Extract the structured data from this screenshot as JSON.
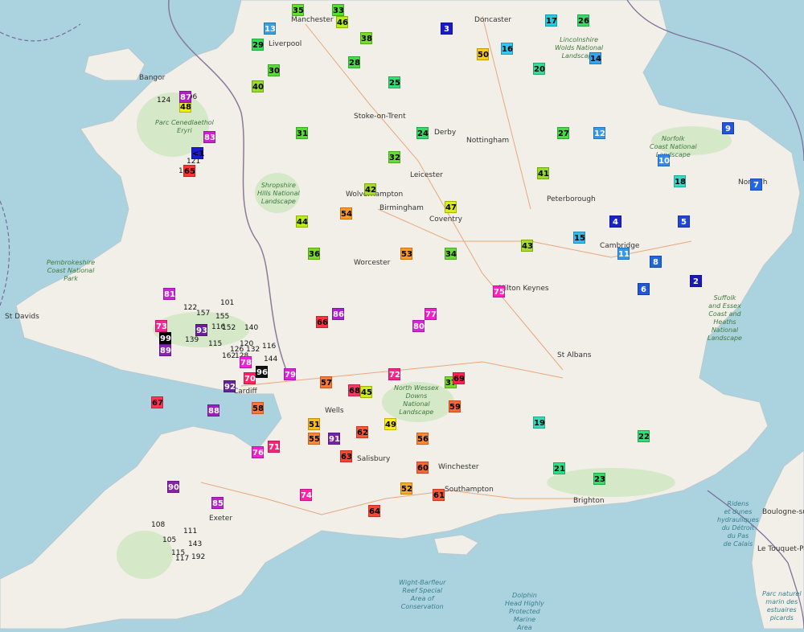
{
  "map": {
    "colors": {
      "sea": "#aad3df",
      "land": "#f2efe9",
      "park": "#cde6bf",
      "border": "#8a7a9a"
    },
    "markers": [
      {
        "v": "35",
        "c": "#66dd33"
      },
      {
        "v": "33",
        "c": "#55dd33"
      },
      {
        "v": "13",
        "c": "#33a0e8"
      },
      {
        "v": "29",
        "c": "#33dd55"
      },
      {
        "v": "3",
        "c": "#1a1acc"
      },
      {
        "v": "17",
        "c": "#22ccdd"
      },
      {
        "v": "26",
        "c": "#33dd66"
      },
      {
        "v": "46",
        "c": "#bbee11"
      },
      {
        "v": "50",
        "c": "#ffcc11"
      },
      {
        "v": "40",
        "c": "#99dd22"
      },
      {
        "v": "16",
        "c": "#33c8ee"
      },
      {
        "v": "38",
        "c": "#77dd22"
      },
      {
        "v": "25",
        "c": "#33dd77"
      },
      {
        "v": "20",
        "c": "#33dd99"
      },
      {
        "v": "14",
        "c": "#33a6ee"
      },
      {
        "v": "9",
        "c": "#2255dd"
      },
      {
        "v": "5",
        "c": "#2244dd"
      },
      {
        "v": "4",
        "c": "#1a22cc"
      },
      {
        "v": "8",
        "c": "#2266dd"
      },
      {
        "v": "2",
        "c": "#1a1abb"
      },
      {
        "v": "6",
        "c": "#2255dd"
      },
      {
        "v": "12",
        "c": "#3399ee"
      },
      {
        "v": "10",
        "c": "#3388ee"
      },
      {
        "v": "7",
        "c": "#2266ee"
      },
      {
        "v": "11",
        "c": "#3399ee"
      },
      {
        "v": "15",
        "c": "#33bbee"
      },
      {
        "v": "18",
        "c": "#33ddcc"
      },
      {
        "v": "19",
        "c": "#33ddbb"
      },
      {
        "v": "21",
        "c": "#33dd88"
      },
      {
        "v": "22",
        "c": "#33dd77"
      },
      {
        "v": "23",
        "c": "#33dd66"
      },
      {
        "v": "24",
        "c": "#33dd66"
      },
      {
        "v": "27",
        "c": "#44dd44"
      },
      {
        "v": "28",
        "c": "#44dd44"
      },
      {
        "v": "30",
        "c": "#55dd33"
      },
      {
        "v": "31",
        "c": "#55dd33"
      },
      {
        "v": "32",
        "c": "#66dd33"
      },
      {
        "v": "34",
        "c": "#66dd33"
      },
      {
        "v": "36",
        "c": "#77dd22"
      },
      {
        "v": "37",
        "c": "#77dd22"
      },
      {
        "v": "41",
        "c": "#99dd22"
      },
      {
        "v": "42",
        "c": "#aadd22"
      },
      {
        "v": "43",
        "c": "#aadd22"
      },
      {
        "v": "44",
        "c": "#bbee11"
      },
      {
        "v": "45",
        "c": "#ccee11"
      },
      {
        "v": "47",
        "c": "#ddee11"
      },
      {
        "v": "48",
        "c": "#eeee11"
      },
      {
        "v": "49",
        "c": "#ffee11"
      },
      {
        "v": "51",
        "c": "#ffbb11"
      },
      {
        "v": "52",
        "c": "#ffaa22"
      },
      {
        "v": "53",
        "c": "#ff9922"
      },
      {
        "v": "54",
        "c": "#ff9922"
      },
      {
        "v": "55",
        "c": "#ff8833"
      },
      {
        "v": "56",
        "c": "#ff8833"
      },
      {
        "v": "57",
        "c": "#ff7733"
      },
      {
        "v": "58",
        "c": "#ff7733"
      },
      {
        "v": "59",
        "c": "#ff6633"
      },
      {
        "v": "60",
        "c": "#ff6633"
      },
      {
        "v": "61",
        "c": "#ff5533"
      },
      {
        "v": "62",
        "c": "#ff5533"
      },
      {
        "v": "63",
        "c": "#ff4433"
      },
      {
        "v": "64",
        "c": "#ff4433"
      },
      {
        "v": "65",
        "c": "#ff3333"
      },
      {
        "v": "66",
        "c": "#ff3344"
      },
      {
        "v": "67",
        "c": "#ff3355"
      },
      {
        "v": "68",
        "c": "#ff3366"
      },
      {
        "v": "69",
        "c": "#ff2255"
      },
      {
        "v": "70",
        "c": "#ff2266"
      },
      {
        "v": "71",
        "c": "#ff2277"
      },
      {
        "v": "72",
        "c": "#ff2288"
      },
      {
        "v": "73",
        "c": "#ff2299"
      },
      {
        "v": "74",
        "c": "#ff22aa"
      },
      {
        "v": "75",
        "c": "#ff22bb"
      },
      {
        "v": "76",
        "c": "#ee22cc"
      },
      {
        "v": "77",
        "c": "#ee22cc"
      },
      {
        "v": "78",
        "c": "#ee22dd"
      },
      {
        "v": "79",
        "c": "#dd22dd"
      },
      {
        "v": "80",
        "c": "#dd22dd"
      },
      {
        "v": "81",
        "c": "#cc22dd"
      },
      {
        "v": "83",
        "c": "#cc22cc"
      },
      {
        "v": "85",
        "c": "#bb22cc"
      },
      {
        "v": "86",
        "c": "#aa22cc"
      },
      {
        "v": "87",
        "c": "#aa22bb"
      },
      {
        "v": "88",
        "c": "#9922bb"
      },
      {
        "v": "89",
        "c": "#8822bb"
      },
      {
        "v": "90",
        "c": "#8822aa"
      },
      {
        "v": "91",
        "c": "#7722aa"
      },
      {
        "v": "92",
        "c": "#662299"
      },
      {
        "v": "93",
        "c": "#662299"
      },
      {
        "v": "96",
        "c": "#111111"
      },
      {
        "v": "99",
        "c": "#000000"
      },
      {
        "v": "<1",
        "c": "#1a1acc"
      }
    ],
    "plain_values": [
      "124",
      "106",
      "129",
      "121",
      "157",
      "101",
      "122",
      "116",
      "152",
      "155",
      "140",
      "139",
      "120",
      "115",
      "132",
      "162",
      "128",
      "126",
      "116",
      "144",
      "108",
      "111",
      "143",
      "105",
      "115",
      "192",
      "117"
    ],
    "places": [
      "Liverpool",
      "Manchester",
      "Doncaster",
      "Bangor",
      "Stoke-on-Trent",
      "Derby",
      "Nottingham",
      "Leicester",
      "Wolverhampton",
      "Birmingham",
      "Coventry",
      "Peterborough",
      "Norwich",
      "Cambridge",
      "Milton Keynes",
      "Worcester",
      "St Davids",
      "Cardiff",
      "St Albans",
      "Wells",
      "Salisbury",
      "Winchester",
      "Southampton",
      "Brighton",
      "Exeter",
      "Boulogne-sur-Mer",
      "Le Touquet-Paris-Plage"
    ],
    "parks": [
      "Parc Cenedlaethol\nEryri",
      "Shropshire\nHills National\nLandscape",
      "Pembrokeshire\nCoast National\nPark",
      "North Wessex\nDowns\nNational\nLandscape",
      "Norfolk\nCoast National\nLandscape",
      "Suffolk\nand Essex\nCoast and\nHeaths\nNational\nLandscape",
      "Lincolnshire\nWolds National\nLandscape"
    ],
    "sea_labels": [
      "Wight-Barfleur\nReef Special\nArea of\nConservation",
      "Dolphin\nHead Highly\nProtected\nMarine\nArea",
      "Ridens\net dunes\nhydrauliques\ndu Détroit\ndu Pas\nde Calais",
      "Parc naturel\nmarin des\nestuaires\npicards"
    ]
  }
}
